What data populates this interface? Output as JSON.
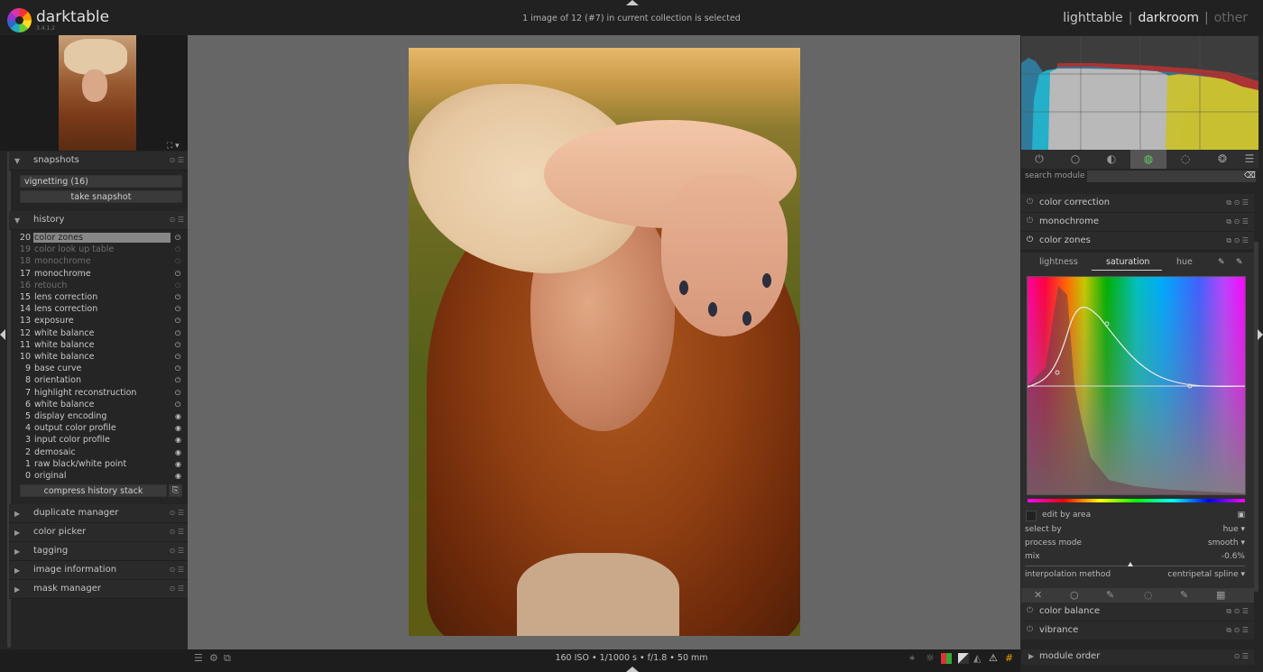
{
  "app": {
    "name": "darktable",
    "version": "3.4.1.2"
  },
  "header": {
    "collection_status": "1 image of 12 (#7) in current collection is selected"
  },
  "views": {
    "lighttable": "lighttable",
    "darkroom": "darkroom",
    "other": "other",
    "sep": "|"
  },
  "left": {
    "snapshots": {
      "title": "snapshots",
      "current": "vignetting (16)",
      "take_snapshot": "take snapshot"
    },
    "history": {
      "title": "history",
      "items": [
        {
          "num": "20",
          "name": "color zones"
        },
        {
          "num": "19",
          "name": "color look up table"
        },
        {
          "num": "18",
          "name": "monochrome"
        },
        {
          "num": "17",
          "name": "monochrome"
        },
        {
          "num": "16",
          "name": "retouch"
        },
        {
          "num": "15",
          "name": "lens correction"
        },
        {
          "num": "14",
          "name": "lens correction"
        },
        {
          "num": "13",
          "name": "exposure"
        },
        {
          "num": "12",
          "name": "white balance"
        },
        {
          "num": "11",
          "name": "white balance"
        },
        {
          "num": "10",
          "name": "white balance"
        },
        {
          "num": "9",
          "name": "base curve"
        },
        {
          "num": "8",
          "name": "orientation"
        },
        {
          "num": "7",
          "name": "highlight reconstruction"
        },
        {
          "num": "6",
          "name": "white balance"
        },
        {
          "num": "5",
          "name": "display encoding"
        },
        {
          "num": "4",
          "name": "output color profile"
        },
        {
          "num": "3",
          "name": "input color profile"
        },
        {
          "num": "2",
          "name": "demosaic"
        },
        {
          "num": "1",
          "name": "raw black/white point"
        },
        {
          "num": "0",
          "name": "original"
        }
      ],
      "compress": "compress history stack"
    },
    "modules": [
      "duplicate manager",
      "color picker",
      "tagging",
      "image information",
      "mask manager"
    ]
  },
  "bottom": {
    "exif": "160 ISO • 1/1000 s • f/1.8 • 50 mm"
  },
  "right": {
    "search_label": "search module",
    "modules_top": [
      "color correction",
      "monochrome",
      "color zones"
    ],
    "color_zones": {
      "tabs": [
        "lightness",
        "saturation",
        "hue"
      ],
      "edit_by_area": "edit by area",
      "select_by": {
        "label": "select by",
        "value": "hue ▾"
      },
      "process_mode": {
        "label": "process mode",
        "value": "smooth ▾"
      },
      "mix": {
        "label": "mix",
        "value": "-0.6%"
      },
      "interpolation": {
        "label": "interpolation method",
        "value": "centripetal spline ▾"
      }
    },
    "modules_bottom": [
      "color balance",
      "vibrance"
    ],
    "module_order": "module order"
  }
}
